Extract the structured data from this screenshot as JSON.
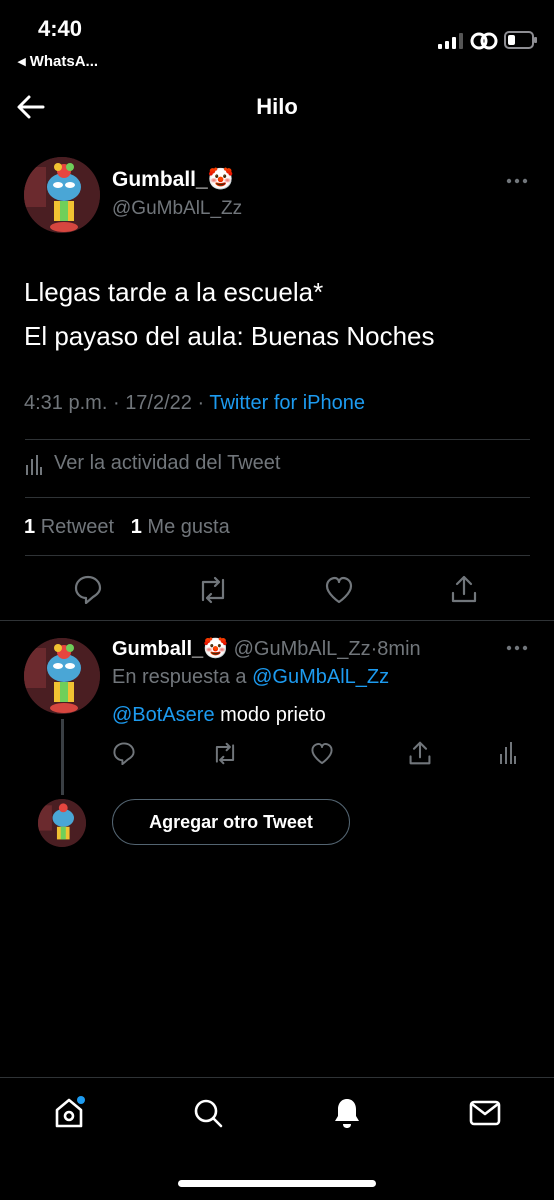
{
  "status_bar": {
    "time": "4:40",
    "back_app": "◂ WhatsA..."
  },
  "header": {
    "title": "Hilo"
  },
  "tweet": {
    "display_name": "Gumball_",
    "emoji": "🤡",
    "handle": "@GuMbAlL_Zz",
    "text_line1": "Llegas tarde a la escuela*",
    "text_line2": "El payaso del aula: Buenas Noches",
    "time": "4:31 p.m.",
    "date": "17/2/22",
    "sep": "·",
    "source": "Twitter for iPhone",
    "activity": "Ver la actividad del Tweet",
    "retweet_count": "1",
    "retweet_label": "Retweet",
    "like_count": "1",
    "like_label": "Me gusta"
  },
  "reply": {
    "display_name": "Gumball_",
    "emoji": "🤡",
    "handle": "@GuMbAlL_Zz",
    "time": "8min",
    "sep": "·",
    "in_reply_prefix": "En respuesta a",
    "in_reply_handle": "@GuMbAlL_Zz",
    "mention": "@BotAsere",
    "text": "modo prieto"
  },
  "add_tweet_button": "Agregar otro Tweet",
  "icons": {
    "back": "arrow-left-icon",
    "more": "more-icon",
    "reply": "reply-icon",
    "retweet": "retweet-icon",
    "like": "heart-icon",
    "share": "share-icon",
    "analytics": "analytics-icon",
    "home": "home-icon",
    "search": "search-icon",
    "notifications": "bell-icon",
    "messages": "mail-icon"
  },
  "colors": {
    "background": "#000000",
    "text": "#ffffff",
    "muted": "#71767b",
    "accent": "#1d9bf0",
    "divider": "#2f3336"
  }
}
